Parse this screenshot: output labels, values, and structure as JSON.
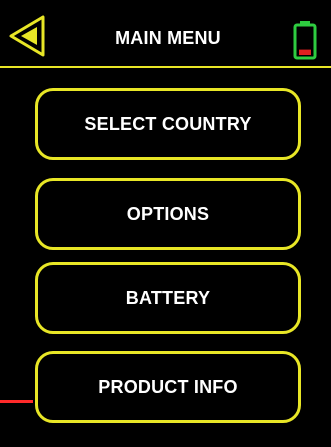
{
  "header": {
    "title": "MAIN MENU",
    "back_icon": "back-arrow-icon",
    "battery_icon": "battery-low-icon",
    "battery_level": 0.2
  },
  "menu": {
    "items": [
      {
        "label": "SELECT COUNTRY"
      },
      {
        "label": "OPTIONS"
      },
      {
        "label": "BATTERY"
      },
      {
        "label": "PRODUCT INFO"
      }
    ]
  },
  "colors": {
    "background": "#000000",
    "accent": "#e8e626",
    "text": "#ffffff",
    "battery_frame": "#2ecc40",
    "battery_fill": "#e02020",
    "marker": "#ff2a2a"
  }
}
